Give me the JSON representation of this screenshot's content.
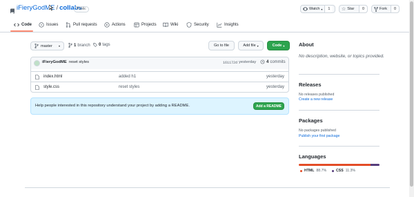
{
  "repo": {
    "owner": "iFieryGodME",
    "separator": "/",
    "name": "collabs",
    "visibility": "Public"
  },
  "header_actions": {
    "watch_label": "Watch",
    "watch_count": "1",
    "star_label": "Star",
    "star_count": "0",
    "fork_label": "Fork",
    "fork_count": "0"
  },
  "tabs": [
    {
      "label": "Code",
      "icon": "code-icon"
    },
    {
      "label": "Issues",
      "icon": "issue-icon"
    },
    {
      "label": "Pull requests",
      "icon": "pull-request-icon"
    },
    {
      "label": "Actions",
      "icon": "play-icon"
    },
    {
      "label": "Projects",
      "icon": "table-icon"
    },
    {
      "label": "Wiki",
      "icon": "book-icon"
    },
    {
      "label": "Security",
      "icon": "shield-icon"
    },
    {
      "label": "Insights",
      "icon": "graph-icon"
    }
  ],
  "toolbar": {
    "branch": "master",
    "branch_count": "1",
    "branch_word": "branch",
    "tag_count": "0",
    "tag_word": "tags",
    "go_to_file": "Go to file",
    "add_file": "Add file",
    "code": "Code"
  },
  "latest_commit": {
    "author": "iFieryGodME",
    "message": "reset styles",
    "hash": "161172d",
    "time": "yesterday",
    "commit_count": "4",
    "commit_word": "commits"
  },
  "files": [
    {
      "name": "index.html",
      "message": "added h1",
      "time": "yesterday"
    },
    {
      "name": "style.css",
      "message": "reset styles",
      "time": "yesterday"
    }
  ],
  "readme_banner": {
    "text": "Help people interested in this repository understand your project by adding a README.",
    "button": "Add a README"
  },
  "about": {
    "title": "About",
    "description": "No description, website, or topics provided."
  },
  "releases": {
    "title": "Releases",
    "empty": "No releases published",
    "link": "Create a new release"
  },
  "packages": {
    "title": "Packages",
    "empty": "No packages published",
    "link": "Publish your first package"
  },
  "languages": {
    "title": "Languages",
    "items": [
      {
        "name": "HTML",
        "percent": "88.7%",
        "value": 88.7,
        "color": "#e34c26"
      },
      {
        "name": "CSS",
        "percent": "11.3%",
        "value": 11.3,
        "color": "#563d7c"
      }
    ]
  },
  "colors": {
    "accent": "#0969da",
    "tab_underline": "#fd8c73",
    "green": "#2da44e",
    "banner_bg": "#ddf4ff"
  }
}
